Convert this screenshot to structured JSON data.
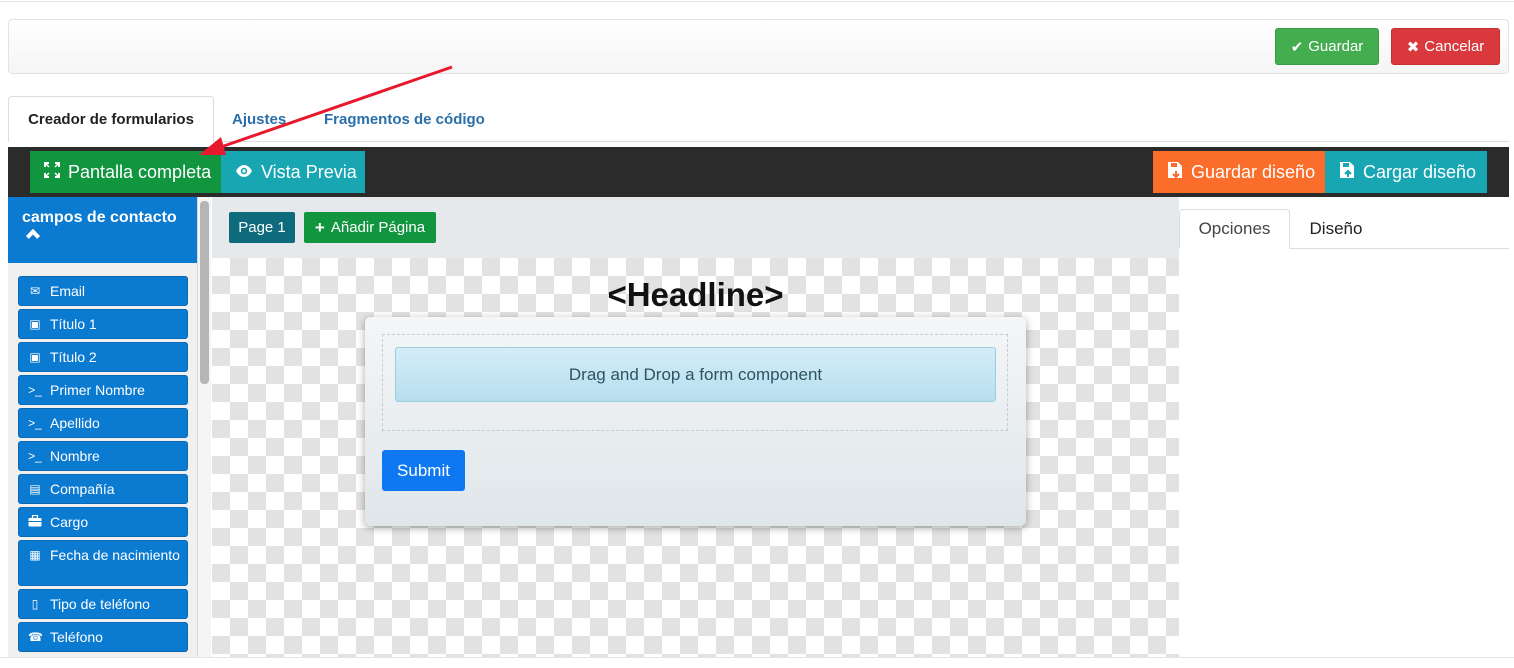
{
  "header": {
    "save_label": "Guardar",
    "cancel_label": "Cancelar"
  },
  "tabs": [
    {
      "label": "Creador de formularios",
      "active": true
    },
    {
      "label": "Ajustes",
      "active": false
    },
    {
      "label": "Fragmentos de código",
      "active": false
    }
  ],
  "toolbar": {
    "fullscreen_label": "Pantalla completa",
    "preview_label": "Vista Previa",
    "save_design_label": "Guardar diseño",
    "load_design_label": "Cargar diseño"
  },
  "sidebar": {
    "title": "campos de contacto",
    "items": [
      {
        "label": "Email",
        "icon": "envelope-icon"
      },
      {
        "label": "Título 1",
        "icon": "dropdown-icon"
      },
      {
        "label": "Título 2",
        "icon": "dropdown-icon"
      },
      {
        "label": "Primer Nombre",
        "icon": "terminal-icon"
      },
      {
        "label": "Apellido",
        "icon": "terminal-icon"
      },
      {
        "label": "Nombre",
        "icon": "terminal-icon"
      },
      {
        "label": "Compañía",
        "icon": "building-icon"
      },
      {
        "label": "Cargo",
        "icon": "briefcase-icon"
      },
      {
        "label": "Fecha de nacimiento",
        "icon": "calendar-icon"
      },
      {
        "label": "Tipo de teléfono",
        "icon": "mobile-icon"
      },
      {
        "label": "Teléfono",
        "icon": "phone-icon"
      }
    ]
  },
  "canvas": {
    "page_label": "Page 1",
    "add_page_label": "Añadir Página",
    "headline": "<Headline>",
    "drop_message": "Drag and Drop a form component",
    "submit_label": "Submit"
  },
  "right_panel": {
    "tabs": [
      "Opciones",
      "Diseño"
    ]
  },
  "colors": {
    "save_green": "#44ad4f",
    "cancel_red": "#d9393c",
    "fullscreen_green": "#11953f",
    "teal": "#18a6b2",
    "orange": "#fb6d2a",
    "sidebar_blue": "#0b7ad1",
    "submit_blue": "#0d78f2",
    "annotation_arrow": "#e8192c"
  }
}
